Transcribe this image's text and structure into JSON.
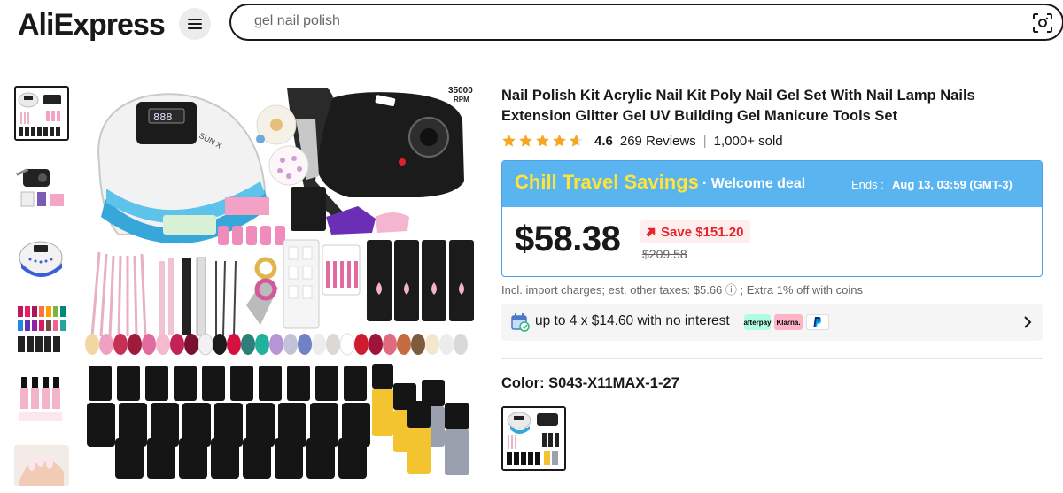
{
  "header": {
    "logo_text": "AliExpress",
    "search_value": "gel nail polish",
    "menu_icon": "hamburger-icon",
    "camera_icon": "image-search-icon"
  },
  "product": {
    "title": "Nail Polish Kit Acrylic Nail Kit Poly Nail Gel Set With Nail Lamp Nails Extension Glitter Gel UV Building Gel Manicure Tools Set",
    "rating": "4.6",
    "stars": 4.6,
    "reviews": "269 Reviews",
    "sold": "1,000+ sold",
    "separator": "|"
  },
  "deal": {
    "name": "Chill Travel Savings",
    "sub": "· Welcome deal",
    "ends_label": "Ends :",
    "ends_time": "Aug 13, 03:59 (GMT-3)",
    "price": "$58.38",
    "save": "Save $151.20",
    "original_price": "$209.58"
  },
  "tax_line": "Incl. import charges; est. other taxes: $5.66 ⓘ ; Extra 1% off with coins",
  "installment": {
    "text": "up to 4 x $14.60 with no interest",
    "afterpay": "afterpay",
    "klarna": "Klarna."
  },
  "color": {
    "label": "Color: S043-X11MAX-1-27"
  },
  "image_text": {
    "rpm_value": "35000",
    "rpm_unit": "RPM",
    "lamp_brand": "SUN X"
  },
  "colors": {
    "accent_orange": "#ff6a00",
    "deal_blue": "#5ab4f0",
    "deal_yellow": "#ffe33b",
    "save_red": "#e8212b",
    "star": "#f5a623"
  }
}
